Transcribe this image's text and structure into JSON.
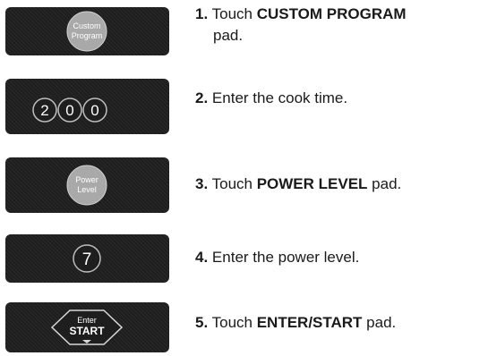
{
  "steps": [
    {
      "number": "1.",
      "pad_label_line1": "Custom",
      "pad_label_line2": "Program",
      "pre": "Touch ",
      "bold": "CUSTOM PROGRAM",
      "post": "",
      "line2": "pad."
    },
    {
      "number": "2.",
      "pad_digits": [
        "2",
        "0",
        "0"
      ],
      "pre": "Enter the cook time.",
      "bold": "",
      "post": ""
    },
    {
      "number": "3.",
      "pad_label_line1": "Power",
      "pad_label_line2": "Level",
      "pre": "Touch ",
      "bold": "POWER LEVEL",
      "post": " pad."
    },
    {
      "number": "4.",
      "pad_digits": [
        "7"
      ],
      "pre": "Enter the power level.",
      "bold": "",
      "post": ""
    },
    {
      "number": "5.",
      "pad_label_line1": "Enter",
      "pad_label_line2": "START",
      "pre": "Touch ",
      "bold": "ENTER/START",
      "post": " pad."
    }
  ],
  "colors": {
    "pad_background": "#1e1e1e",
    "button_fill": "#a9a9a9",
    "text": "#1a1a1a"
  }
}
